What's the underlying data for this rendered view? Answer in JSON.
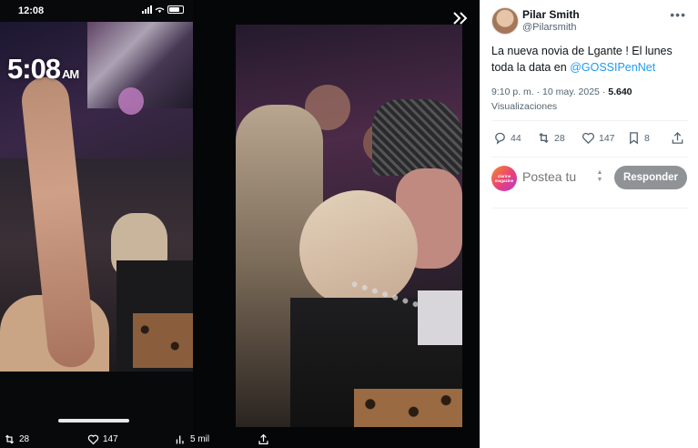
{
  "phone": {
    "status_time": "12:08",
    "story_clock": "5:08",
    "story_clock_suffix": "AM"
  },
  "stats_bar": {
    "retweets": "28",
    "likes": "147",
    "views": "5 mil"
  },
  "tweet": {
    "author_name": "Pilar Smith",
    "author_handle": "@Pilarsmith",
    "text_before": "La nueva novia de Lgante ! El lunes toda la data en ",
    "mention": "@GOSSIPenNet",
    "time": "9:10 p. m.",
    "date": "10 may. 2025",
    "views_count": "5.640",
    "views_label": "Visualizaciones",
    "separator": "·",
    "actions": {
      "replies": "44",
      "retweets": "28",
      "likes": "147",
      "bookmarks": "8"
    }
  },
  "reply": {
    "avatar_text": "clarine magazine",
    "placeholder": "Postea tu",
    "button_label": "Responder"
  },
  "colors": {
    "accent": "#1d9bf0",
    "text_primary": "#0f1419",
    "text_secondary": "#536471",
    "reply_button": "#8f9396"
  }
}
